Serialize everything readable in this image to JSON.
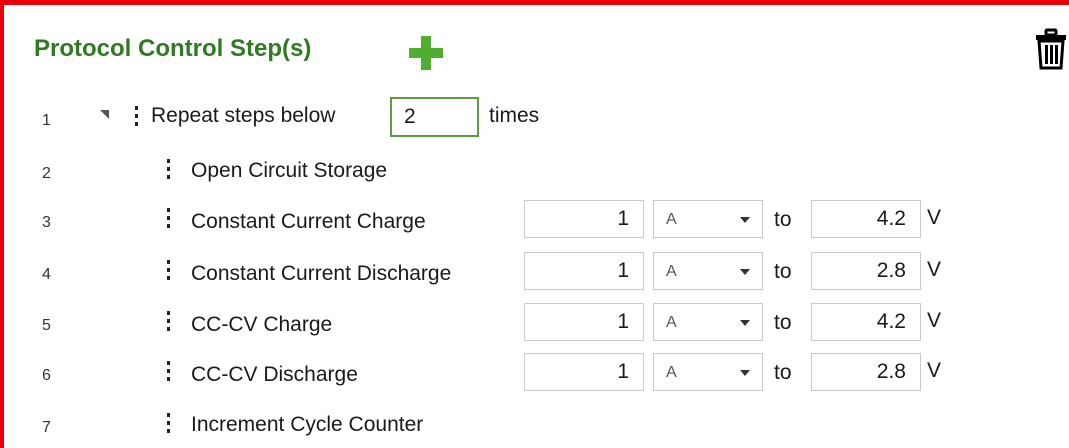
{
  "header": {
    "title": "Protocol Control Step(s)",
    "add_icon": "plus-icon",
    "delete_icon": "trash-icon",
    "accent_color": "#2f7a23",
    "border_color": "#e8000b"
  },
  "repeat": {
    "num": "1",
    "label_before": "Repeat steps below",
    "count": "2",
    "label_after": "times"
  },
  "steps": [
    {
      "num": "2",
      "label": "Open Circuit Storage"
    },
    {
      "num": "3",
      "label": "Constant Current Charge",
      "value": "1",
      "unit": "A",
      "to": "to",
      "target": "4.2",
      "target_unit": "V"
    },
    {
      "num": "4",
      "label": "Constant Current Discharge",
      "value": "1",
      "unit": "A",
      "to": "to",
      "target": "2.8",
      "target_unit": "V"
    },
    {
      "num": "5",
      "label": "CC-CV Charge",
      "value": "1",
      "unit": "A",
      "to": "to",
      "target": "4.2",
      "target_unit": "V"
    },
    {
      "num": "6",
      "label": "CC-CV Discharge",
      "value": "1",
      "unit": "A",
      "to": "to",
      "target": "2.8",
      "target_unit": "V"
    },
    {
      "num": "7",
      "label": "Increment Cycle Counter"
    }
  ]
}
